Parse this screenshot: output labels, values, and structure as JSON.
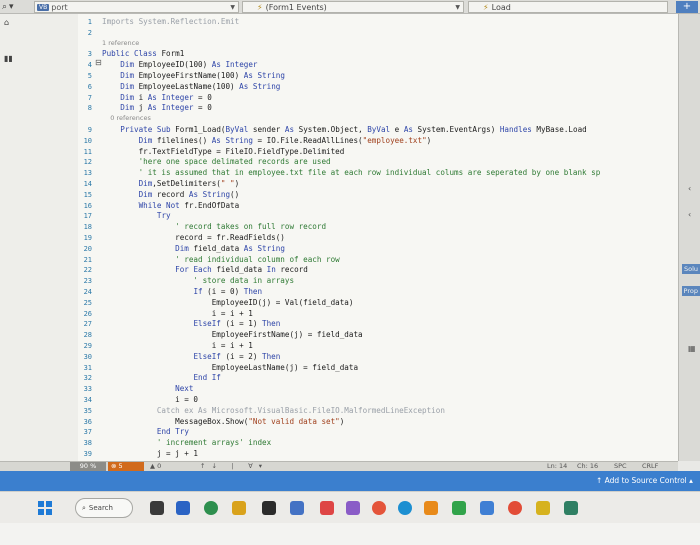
{
  "topbar": {
    "file_name": "port",
    "file_badge": "VB",
    "class_dropdown": "(Form1 Events)",
    "method_dropdown": "Load"
  },
  "editor": {
    "code_lines": [
      {
        "n": "1",
        "text": "Imports System.Reflection.Emit",
        "style": "fade"
      },
      {
        "n": "2",
        "text": "",
        "style": "plain"
      },
      {
        "n": "",
        "text": "1 reference",
        "style": "ref"
      },
      {
        "n": "3",
        "text": "Public Class Form1",
        "style": "plain"
      },
      {
        "n": "4",
        "text": "    Dim EmployeeID(100) As Integer",
        "style": "plain"
      },
      {
        "n": "5",
        "text": "    Dim EmployeeFirstName(100) As String",
        "style": "plain"
      },
      {
        "n": "6",
        "text": "    Dim EmployeeLastName(100) As String",
        "style": "plain"
      },
      {
        "n": "7",
        "text": "    Dim i As Integer = 0",
        "style": "plain"
      },
      {
        "n": "8",
        "text": "    Dim j As Integer = 0",
        "style": "plain"
      },
      {
        "n": "",
        "text": "    0 references",
        "style": "ref"
      },
      {
        "n": "9",
        "text": "    Private Sub Form1_Load(ByVal sender As System.Object, ByVal e As System.EventArgs) Handles MyBase.Load",
        "style": "plain"
      },
      {
        "n": "10",
        "text": "        Dim filelines() As String = IO.File.ReadAllLines(\"employee.txt\")",
        "style": "plain"
      },
      {
        "n": "11",
        "text": "        fr.TextFieldType = FileIO.FieldType.Delimited",
        "style": "plain"
      },
      {
        "n": "12",
        "text": "        'here one space delimated records are used",
        "style": "cm"
      },
      {
        "n": "13",
        "text": "        ' it is assumed that in employee.txt file at each row individual colums are seperated by one blank sp",
        "style": "cm"
      },
      {
        "n": "14",
        "text": "        Dim,SetDelimiters(\" \")",
        "style": "plain"
      },
      {
        "n": "15",
        "text": "        Dim record As String()",
        "style": "plain"
      },
      {
        "n": "16",
        "text": "        While Not fr.EndOfData",
        "style": "plain"
      },
      {
        "n": "17",
        "text": "            Try",
        "style": "plain"
      },
      {
        "n": "18",
        "text": "                ' record takes on full row record",
        "style": "cm"
      },
      {
        "n": "19",
        "text": "                record = fr.ReadFields()",
        "style": "plain"
      },
      {
        "n": "20",
        "text": "                Dim field_data As String",
        "style": "plain"
      },
      {
        "n": "21",
        "text": "                ' read individual column of each row",
        "style": "cm"
      },
      {
        "n": "22",
        "text": "                For Each field_data In record",
        "style": "plain"
      },
      {
        "n": "23",
        "text": "                    ' store data in arrays",
        "style": "cm"
      },
      {
        "n": "24",
        "text": "                    If (i = 0) Then",
        "style": "plain"
      },
      {
        "n": "25",
        "text": "                        EmployeeID(j) = Val(field_data)",
        "style": "plain"
      },
      {
        "n": "26",
        "text": "                        i = i + 1",
        "style": "plain"
      },
      {
        "n": "27",
        "text": "                    ElseIf (i = 1) Then",
        "style": "plain"
      },
      {
        "n": "28",
        "text": "                        EmployeeFirstName(j) = field_data",
        "style": "plain"
      },
      {
        "n": "29",
        "text": "                        i = i + 1",
        "style": "plain"
      },
      {
        "n": "30",
        "text": "                    ElseIf (i = 2) Then",
        "style": "plain"
      },
      {
        "n": "31",
        "text": "                        EmployeeLastName(j) = field_data",
        "style": "plain"
      },
      {
        "n": "32",
        "text": "                    End If",
        "style": "plain"
      },
      {
        "n": "33",
        "text": "                Next",
        "style": "plain"
      },
      {
        "n": "34",
        "text": "                i = 0",
        "style": "plain"
      },
      {
        "n": "35",
        "text": "            Catch ex As Microsoft.VisualBasic.FileIO.MalformedLineException",
        "style": "fade"
      },
      {
        "n": "36",
        "text": "                MessageBox.Show(\"Not valid data set\")",
        "style": "plain"
      },
      {
        "n": "37",
        "text": "            End Try",
        "style": "plain"
      },
      {
        "n": "38",
        "text": "            ' increment arrays' index",
        "style": "cm"
      },
      {
        "n": "39",
        "text": "            j = j + 1",
        "style": "plain"
      }
    ]
  },
  "right_dock": {
    "solution_label": "Solu",
    "properties_label": "Prop"
  },
  "status": {
    "zoom": "90 %",
    "errors": "5",
    "warnings": "0",
    "line": "Ln: 14",
    "col": "Ch: 16",
    "spacing": "SPC",
    "line_endings": "CRLF",
    "source_control": "Add to Source Control"
  },
  "taskbar": {
    "search_label": "Search"
  },
  "colors": {
    "vs_blue": "#3b7fce",
    "error_orange": "#d16a1c",
    "keyword": "#2e45a8",
    "comment": "#2f7a34",
    "string": "#a0411e"
  }
}
